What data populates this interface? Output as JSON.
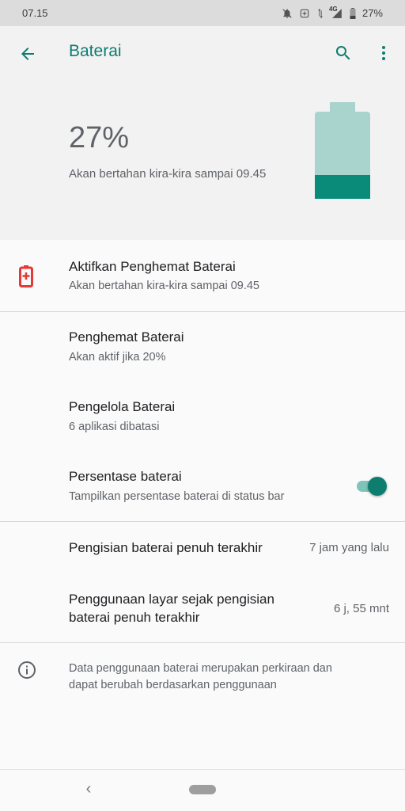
{
  "status_bar": {
    "time": "07.15",
    "network": "4G",
    "battery_pct": "27%",
    "icons": [
      "notifications-off-icon",
      "sync-icon",
      "wifi-arrows-icon",
      "cell-signal-icon",
      "battery-icon"
    ]
  },
  "app_bar": {
    "title": "Baterai",
    "back_icon": "arrow-back-icon",
    "search_icon": "search-icon",
    "more_icon": "more-vert-icon"
  },
  "header": {
    "percentage": "27%",
    "estimate": "Akan bertahan kira-kira sampai 09.45",
    "battery_level": 0.27
  },
  "items": [
    {
      "title": "Aktifkan Penghemat Baterai",
      "subtitle": "Akan bertahan kira-kira sampai 09.45",
      "icon": "battery-alert-icon"
    },
    {
      "title": "Penghemat Baterai",
      "subtitle": "Akan aktif jika 20%"
    },
    {
      "title": "Pengelola Baterai",
      "subtitle": "6 aplikasi dibatasi"
    },
    {
      "title": "Persentase baterai",
      "subtitle": "Tampilkan persentase baterai di status bar",
      "toggle_on": true
    }
  ],
  "stats": [
    {
      "label": "Pengisian baterai penuh terakhir",
      "value": "7 jam yang lalu"
    },
    {
      "label_line1": "Penggunaan layar sejak pengisian",
      "label_line2": "baterai penuh terakhir",
      "value": "6 j, 55 mnt"
    }
  ],
  "info": {
    "icon": "info-icon",
    "line1": "Data penggunaan baterai merupakan perkiraan dan",
    "line2": "dapat berubah berdasarkan penggunaan"
  },
  "nav": {
    "back_glyph": "‹"
  },
  "colors": {
    "accent": "#0c7d6f",
    "battery_fill": "#0a8a78",
    "battery_empty": "#a8d4cd",
    "alert": "#e53935"
  }
}
